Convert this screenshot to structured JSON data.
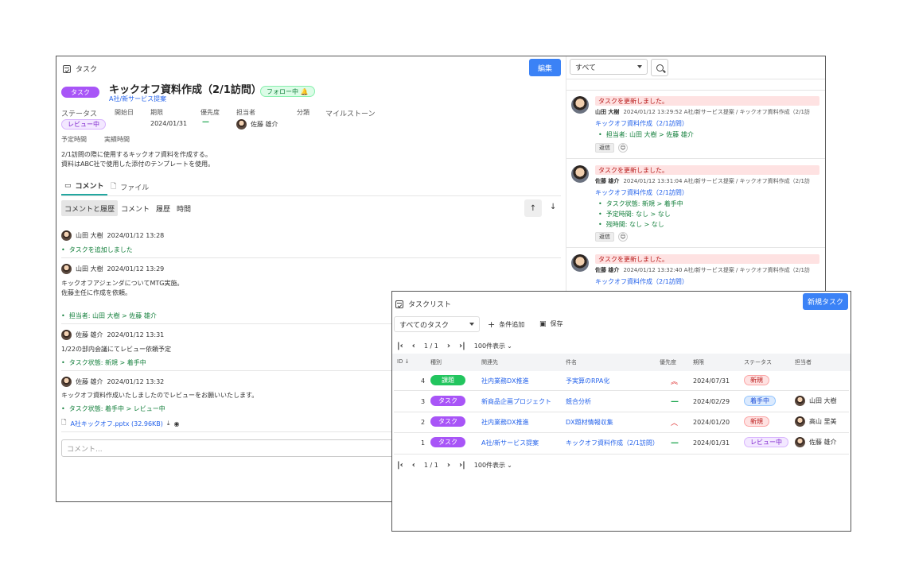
{
  "task_detail": {
    "header_label": "タスク",
    "edit_button": "編集",
    "type_badge": "タスク",
    "title": "キックオフ資料作成（2/1訪問）",
    "follow_badge": "フォロー中 🔔",
    "project_link": "A社/新サービス提案",
    "fields": {
      "status_label": "ステータス",
      "start_label": "開始日",
      "due_label": "期限",
      "priority_label": "優先度",
      "assignee_label": "担当者",
      "category_label": "分類",
      "milestone_label": "マイルストーン",
      "status_value": "レビュー中",
      "due_value": "2024/01/31",
      "priority_value": "—",
      "assignee_value": "佐藤 雄介"
    },
    "planned_time_label": "予定時間",
    "actual_time_label": "実績時間",
    "description_line1": "2/1訪問の際に使用するキックオフ資料を作成する。",
    "description_line2": "資料はABC社で使用した添付のテンプレートを使用。",
    "tabs": [
      "コメント",
      "ファイル"
    ],
    "filters": [
      "コメントと履歴",
      "コメント",
      "履歴",
      "時間"
    ],
    "sort_up": "↑",
    "sort_down": "↓",
    "comments": [
      {
        "author": "山田 大樹",
        "time": "2024/01/12 13:28",
        "body": "",
        "change": "タスクを追加しました"
      },
      {
        "author": "山田 大樹",
        "time": "2024/01/12 13:29",
        "body": "キックオフアジェンダについてMTG実施。",
        "body2": "佐藤主任に作成を依頼。",
        "change": "担当者: 山田 大樹 > 佐藤 雄介"
      },
      {
        "author": "佐藤 雄介",
        "time": "2024/01/12 13:31",
        "body": "1/22の部内会議にてレビュー依頼予定",
        "change": "タスク状態: 新規 > 着手中"
      },
      {
        "author": "佐藤 雄介",
        "time": "2024/01/12 13:32",
        "body": "キックオフ資料作成いたしましたのでレビューをお願いいたします。",
        "change": "タスク状態: 着手中 > レビュー中",
        "attachment": "A社キックオフ.pptx (32.96KB)"
      }
    ],
    "comment_placeholder": "コメント..."
  },
  "activity": {
    "filter_value": "すべて",
    "items": [
      {
        "banner": "タスクを更新しました。",
        "author": "山田 大樹",
        "meta": "2024/01/12 13:29:52  A社/新サービス提案 / キックオフ資料作成（2/1訪",
        "link": "キックオフ資料作成（2/1訪問）",
        "changes": [
          "担当者: 山田 大樹 > 佐藤 雄介"
        ],
        "reply": "返信"
      },
      {
        "banner": "タスクを更新しました。",
        "author": "佐藤 雄介",
        "meta": "2024/01/12 13:31:04  A社/新サービス提案 / キックオフ資料作成（2/1訪",
        "link": "キックオフ資料作成（2/1訪問）",
        "changes": [
          "タスク状態: 新規 > 着手中",
          "予定時間: なし > なし",
          "残時間: なし > なし"
        ],
        "reply": "返信"
      },
      {
        "banner": "タスクを更新しました。",
        "author": "佐藤 雄介",
        "meta": "2024/01/12 13:32:40  A社/新サービス提案 / キックオフ資料作成（2/1訪",
        "link": "キックオフ資料作成（2/1訪問）",
        "changes": [],
        "reply": ""
      }
    ]
  },
  "task_list": {
    "header_label": "タスクリスト",
    "new_task_button": "新規タスク",
    "view_select": "すべてのタスク",
    "add_condition": "条件追加",
    "save": "保存",
    "pager": {
      "page": "1 / 1",
      "per_page": "100件表示"
    },
    "columns": [
      "ID ↓",
      "種別",
      "関連先",
      "件名",
      "優先度",
      "期限",
      "ステータス",
      "担当者"
    ],
    "rows": [
      {
        "id": "4",
        "type": "課題",
        "related": "社内業務DX推進",
        "subject": "予実算のRPA化",
        "priority": "︽",
        "due": "2024/07/31",
        "status": "新規",
        "assignee": ""
      },
      {
        "id": "3",
        "type": "タスク",
        "related": "新商品企画プロジェクト",
        "subject": "競合分析",
        "priority": "—",
        "due": "2024/02/29",
        "status": "着手中",
        "assignee": "山田 大樹"
      },
      {
        "id": "2",
        "type": "タスク",
        "related": "社内業務DX推進",
        "subject": "DX題材情報収集",
        "priority": "︿",
        "due": "2024/01/20",
        "status": "新規",
        "assignee": "高山 里美"
      },
      {
        "id": "1",
        "type": "タスク",
        "related": "A社/新サービス提案",
        "subject": "キックオフ資料作成（2/1訪問）",
        "priority": "—",
        "due": "2024/01/31",
        "status": "レビュー中",
        "assignee": "佐藤 雄介"
      }
    ]
  }
}
